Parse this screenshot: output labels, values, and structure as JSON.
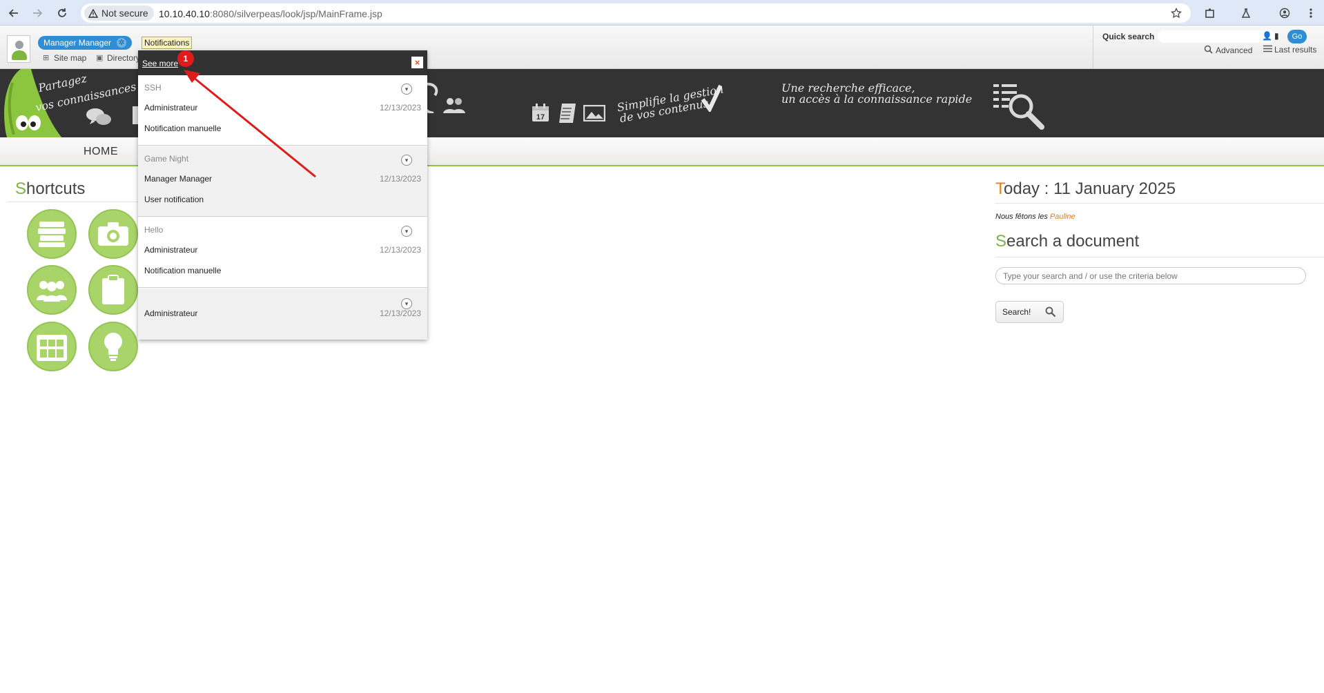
{
  "browser": {
    "security_label": "Not secure",
    "url_host": "10.10.40.10",
    "url_rest": ":8080/silverpeas/look/jsp/MainFrame.jsp",
    "icons": [
      "back-icon",
      "forward-icon",
      "reload-icon",
      "warning-icon",
      "star-icon",
      "extensions-icon",
      "labs-icon",
      "profile-icon",
      "menu-icon"
    ]
  },
  "topbar": {
    "user_name": "Manager Manager",
    "notifications_label": "Notifications",
    "site_map_label": "Site map",
    "directory_label": "Directory",
    "quick_search_label": "Quick search",
    "go_label": "Go",
    "advanced_label": "Advanced",
    "last_results_label": "Last results"
  },
  "banner": {
    "slogan_1_line1": "Partagez",
    "slogan_1_line2": "vos connaissances",
    "slogan_2_line1": "Simplifie la gestion",
    "slogan_2_line2": "de vos contenus",
    "slogan_3_line1": "Une recherche efficace,",
    "slogan_3_line2": "un accès à la connaissance rapide",
    "calendar_day": "17"
  },
  "menu": {
    "home_label": "HOME"
  },
  "shortcuts": {
    "title_initial": "S",
    "title_rest": "hortcuts",
    "items": [
      {
        "icon": "books-icon"
      },
      {
        "icon": "camera-icon"
      },
      {
        "icon": "community-icon"
      },
      {
        "icon": "clipboard-icon"
      },
      {
        "icon": "calendar-grid-icon"
      },
      {
        "icon": "lightbulb-icon"
      }
    ]
  },
  "today": {
    "title_initial": "T",
    "title_rest": "oday : 11 January 2025",
    "feast_prefix": "Nous fêtons les",
    "feast_name": "Pauline"
  },
  "doc_search": {
    "title_initial": "S",
    "title_rest": "earch a document",
    "placeholder": "Type your search and / or use the criteria below",
    "button_label": "Search!"
  },
  "notifications": {
    "see_more_label": "See more",
    "close_label": "×",
    "items": [
      {
        "subject": "SSH",
        "sender": "Administrateur",
        "date": "12/13/2023",
        "message": "Notification manuelle"
      },
      {
        "subject": "Game Night",
        "sender": "Manager Manager",
        "date": "12/13/2023",
        "message": "User notification"
      },
      {
        "subject": "Hello",
        "sender": "Administrateur",
        "date": "12/13/2023",
        "message": "Notification manuelle"
      },
      {
        "subject": "",
        "sender": "Administrateur",
        "date": "12/13/2023",
        "message": ""
      }
    ]
  },
  "annotation": {
    "badge_number": "1",
    "arrow_color": "#e01b1b"
  },
  "colors": {
    "accent_green": "#7cb342",
    "accent_orange": "#e67e22",
    "accent_blue": "#2f8ed3",
    "banner_dark": "#333333"
  }
}
